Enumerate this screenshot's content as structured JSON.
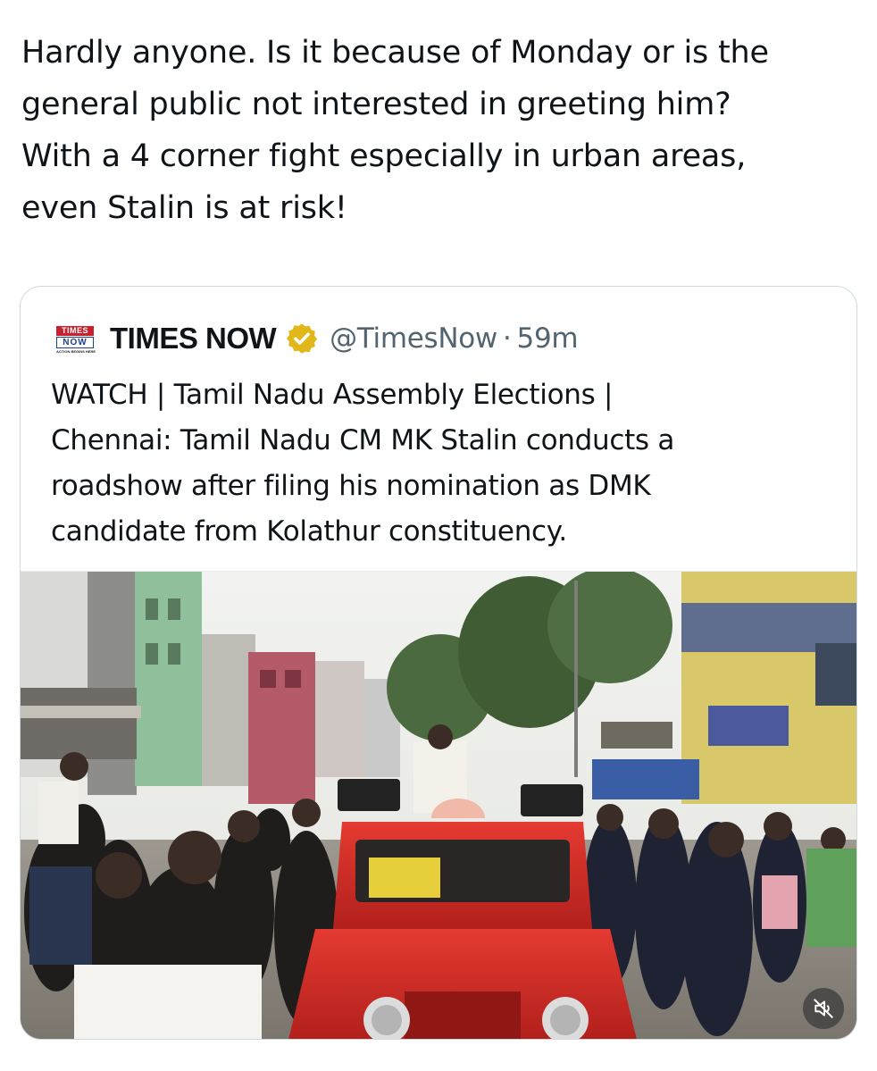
{
  "tweet": {
    "text_lines": [
      "Hardly anyone. Is it because of Monday or is the",
      "general public not interested in greeting him?",
      "With a 4 corner fight especially in urban areas,",
      "even Stalin is at risk!"
    ]
  },
  "quoted_tweet": {
    "avatar_icon": "times-now-logo-icon",
    "avatar_logo_text": {
      "top": "TIMES",
      "bottom": "NOW",
      "tagline": "ACTION BEGINS HERE"
    },
    "display_name": "TIMES NOW",
    "verified_badge": "gold-verified-icon",
    "handle": "@TimesNow",
    "separator": "·",
    "timestamp": "59m",
    "text_lines": [
      "WATCH | Tamil Nadu Assembly Elections |",
      "Chennai: Tamil Nadu CM MK Stalin conducts a",
      "roadshow after filing his nomination as DMK",
      "candidate from Kolathur constituency."
    ],
    "media": {
      "type": "video",
      "mute_icon": "speaker-muted-icon"
    }
  },
  "colors": {
    "text_primary": "#0f1419",
    "text_secondary": "#536471",
    "card_border": "#cfd9de",
    "verified_gold": "#e2b719",
    "times_red": "#c8202f",
    "now_blue": "#1d3f8f"
  }
}
